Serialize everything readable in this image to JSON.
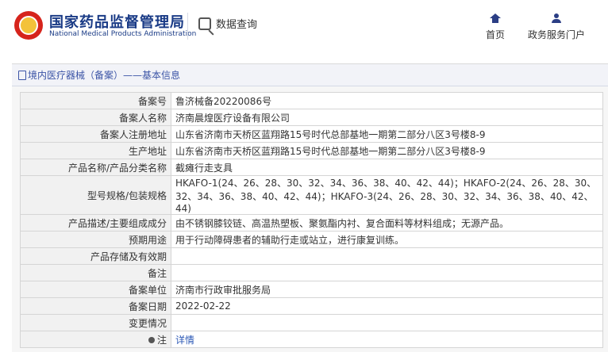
{
  "header": {
    "agency_cn": "国家药品监督管理局",
    "agency_en": "National Medical Products Administration",
    "query_label": "数据查询",
    "nav_home": "首页",
    "nav_service": "政务服务门户"
  },
  "breadcrumb": "境内医疗器械（备案）——基本信息",
  "table": [
    {
      "label": "备案号",
      "value": "鲁济械备20220086号"
    },
    {
      "label": "备案人名称",
      "value": "济南晨煌医疗设备有限公司"
    },
    {
      "label": "备案人注册地址",
      "value": "山东省济南市天桥区蓝翔路15号时代总部基地一期第二部分八区3号楼8-9"
    },
    {
      "label": "生产地址",
      "value": "山东省济南市天桥区蓝翔路15号时代总部基地一期第二部分八区3号楼8-9"
    },
    {
      "label": "产品名称/产品分类名称",
      "value": "截瘫行走支具"
    },
    {
      "label": "型号规格/包装规格",
      "value": "HKAFO-1(24、26、28、30、32、34、36、38、40、42、44)；HKAFO-2(24、26、28、30、32、34、36、38、40、42、44)；HKAFO-3(24、26、28、30、32、34、36、38、40、42、44)"
    },
    {
      "label": "产品描述/主要组成成分",
      "value": "由不锈钢膝铰链、高温热塑板、聚氨酯内衬、复合面料等材料组成；无源产品。"
    },
    {
      "label": "预期用途",
      "value": "用于行动障碍患者的辅助行走或站立，进行康复训练。"
    },
    {
      "label": "产品存储及有效期",
      "value": ""
    },
    {
      "label": "备注",
      "value": ""
    },
    {
      "label": "备案单位",
      "value": "济南市行政审批服务局"
    },
    {
      "label": "备案日期",
      "value": "2022-02-22"
    },
    {
      "label": "变更情况",
      "value": ""
    },
    {
      "label": "注",
      "value": "详情"
    }
  ]
}
